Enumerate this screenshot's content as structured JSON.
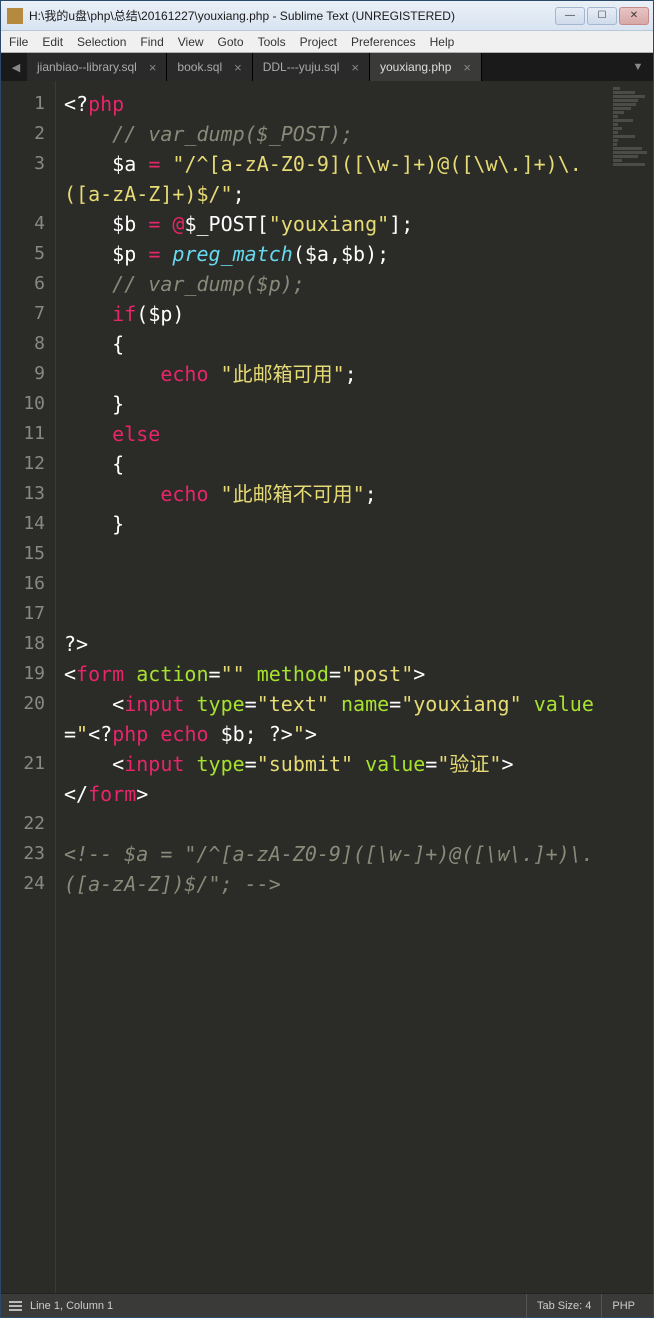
{
  "window": {
    "title": "H:\\我的u盘\\php\\总结\\20161227\\youxiang.php - Sublime Text (UNREGISTERED)"
  },
  "menubar": [
    "File",
    "Edit",
    "Selection",
    "Find",
    "View",
    "Goto",
    "Tools",
    "Project",
    "Preferences",
    "Help"
  ],
  "tabs": [
    {
      "label": "jianbiao--library.sql",
      "active": false
    },
    {
      "label": "book.sql",
      "active": false
    },
    {
      "label": "DDL---yuju.sql",
      "active": false
    },
    {
      "label": "youxiang.php",
      "active": true
    }
  ],
  "line_numbers": [
    "1",
    "2",
    "3",
    "4",
    "5",
    "6",
    "7",
    "8",
    "9",
    "10",
    "11",
    "12",
    "13",
    "14",
    "15",
    "16",
    "17",
    "18",
    "19",
    "20",
    "21",
    "22",
    "23",
    "24"
  ],
  "status": {
    "cursor": "Line 1, Column 1",
    "tabsize": "Tab Size: 4",
    "lang": "PHP"
  },
  "code_plain": "<?php\n    // var_dump($_POST);\n    $a = \"/^[a-zA-Z0-9]([\\w-]+)@([\\w\\.]+)\\.([a-zA-Z]+)$/\";\n    $b = @$_POST[\"youxiang\"];\n    $p = preg_match($a,$b);\n    // var_dump($p);\n    if($p)\n    {\n        echo \"此邮箱可用\";\n    }\n    else\n    {\n        echo \"此邮箱不可用\";\n    }\n\n\n\n?>\n<form action=\"\" method=\"post\">\n    <input type=\"text\" name=\"youxiang\" value=\"<?php echo $b; ?>\">\n    <input type=\"submit\" value=\"验证\">\n</form>\n\n<!-- $a = \"/^[a-zA-Z0-9]([\\w-]+)@([\\w\\.]+)\\.([a-zA-Z])$/\"; -->"
}
